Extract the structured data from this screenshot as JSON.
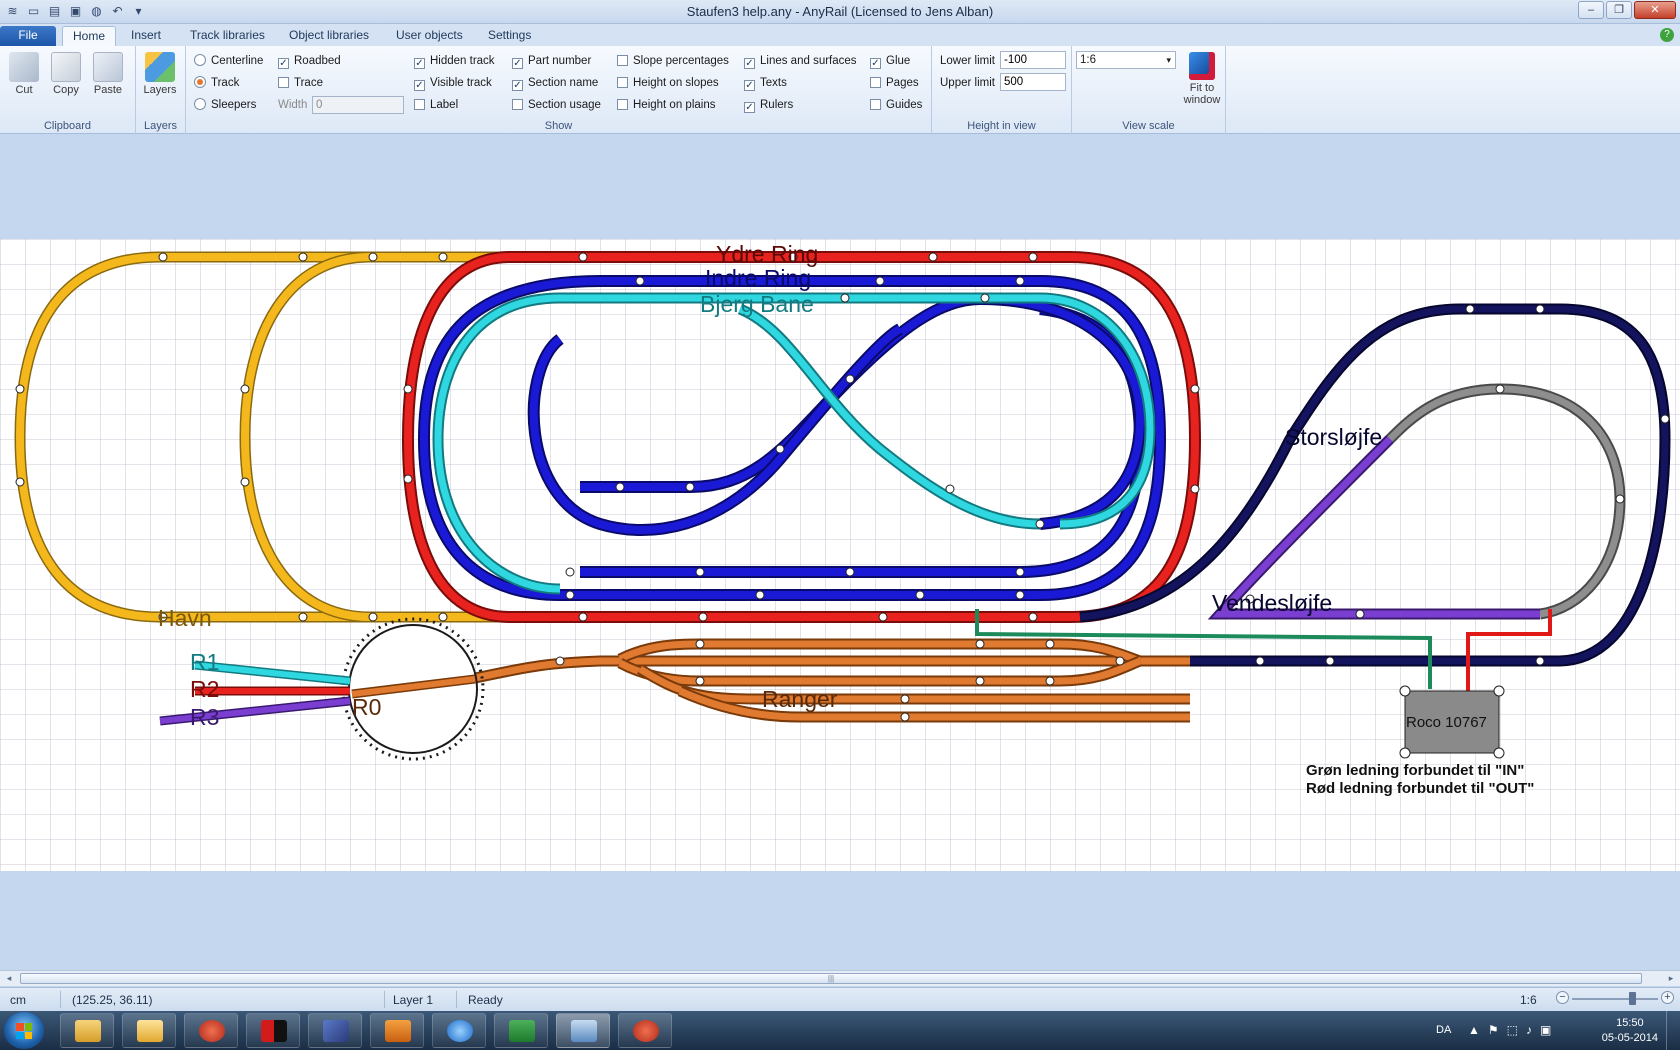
{
  "window": {
    "title": "Staufen3 help.any - AnyRail (Licensed to Jens Alban)",
    "controls": {
      "minimize": "–",
      "maximize": "❐",
      "close": "✕"
    }
  },
  "tabs": [
    "File",
    "Home",
    "Insert",
    "Track libraries",
    "Object libraries",
    "User objects",
    "Settings"
  ],
  "active_tab": "Home",
  "ribbon": {
    "clipboard": {
      "label": "Clipboard",
      "cut": "Cut",
      "copy": "Copy",
      "paste": "Paste"
    },
    "layers": {
      "label": "Layers",
      "button": "Layers"
    },
    "show": {
      "label": "Show",
      "centerline": "Centerline",
      "track": "Track",
      "sleepers": "Sleepers",
      "roadbed": "Roadbed",
      "trace": "Trace",
      "width_label": "Width",
      "width_value": "0",
      "hidden_track": "Hidden track",
      "visible_track": "Visible track",
      "label_opt": "Label",
      "part_number": "Part number",
      "section_name": "Section name",
      "section_usage": "Section usage",
      "slope_percentages": "Slope percentages",
      "height_on_slopes": "Height on slopes",
      "height_on_plains": "Height on plains",
      "lines_and_surfaces": "Lines and surfaces",
      "texts": "Texts",
      "rulers": "Rulers",
      "glue": "Glue",
      "pages": "Pages",
      "guides": "Guides",
      "checked_mark": "✓"
    },
    "height": {
      "label": "Height in view",
      "lower_label": "Lower limit",
      "lower_value": "-100",
      "upper_label": "Upper limit",
      "upper_value": "500"
    },
    "view_scale": {
      "label": "View scale",
      "scale_value": "1:6",
      "fit_label_1": "Fit to",
      "fit_label_2": "window"
    }
  },
  "layout": {
    "labels": {
      "ydre_ring": "Ydre Ring",
      "indre_ring": "Indre Ring",
      "bjerg_bane": "Bjerg Bane",
      "havn": "Havn",
      "storslojfe": "Storsløjfe",
      "vendeslojfe": "Vendesløjfe",
      "ranger": "Ranger",
      "r0": "R0",
      "r1": "R1",
      "r2": "R2",
      "r3": "R3",
      "roco_box": "Roco 10767",
      "note_green": "Grøn ledning forbundet til \"IN\"",
      "note_red": "Rød ledning forbundet til \"OUT\""
    },
    "colors": {
      "yellow": "#f5b81c",
      "red": "#e8221e",
      "blue": "#1a1ad6",
      "cyan": "#2fd8e0",
      "navy": "#14145e",
      "gray": "#8e8e8e",
      "purple": "#7a3fd0",
      "orange": "#e07a30",
      "green_wire": "#1c8a5a",
      "red_wire": "#e01818",
      "grid": "#b8b8c8"
    }
  },
  "scrollbar": {
    "left": "◂",
    "right": "▸",
    "grip": "|||"
  },
  "status": {
    "unit": "cm",
    "coords": "(125.25, 36.11)",
    "layer": "Layer 1",
    "state": "Ready",
    "scale": "1:6",
    "zoom_minus": "−",
    "zoom_plus": "+"
  },
  "taskbar": {
    "lang": "DA",
    "time": "15:50",
    "date": "05-05-2014",
    "tray_icons": [
      "▲",
      "⚑",
      "⬚",
      "♪",
      "▣"
    ]
  }
}
